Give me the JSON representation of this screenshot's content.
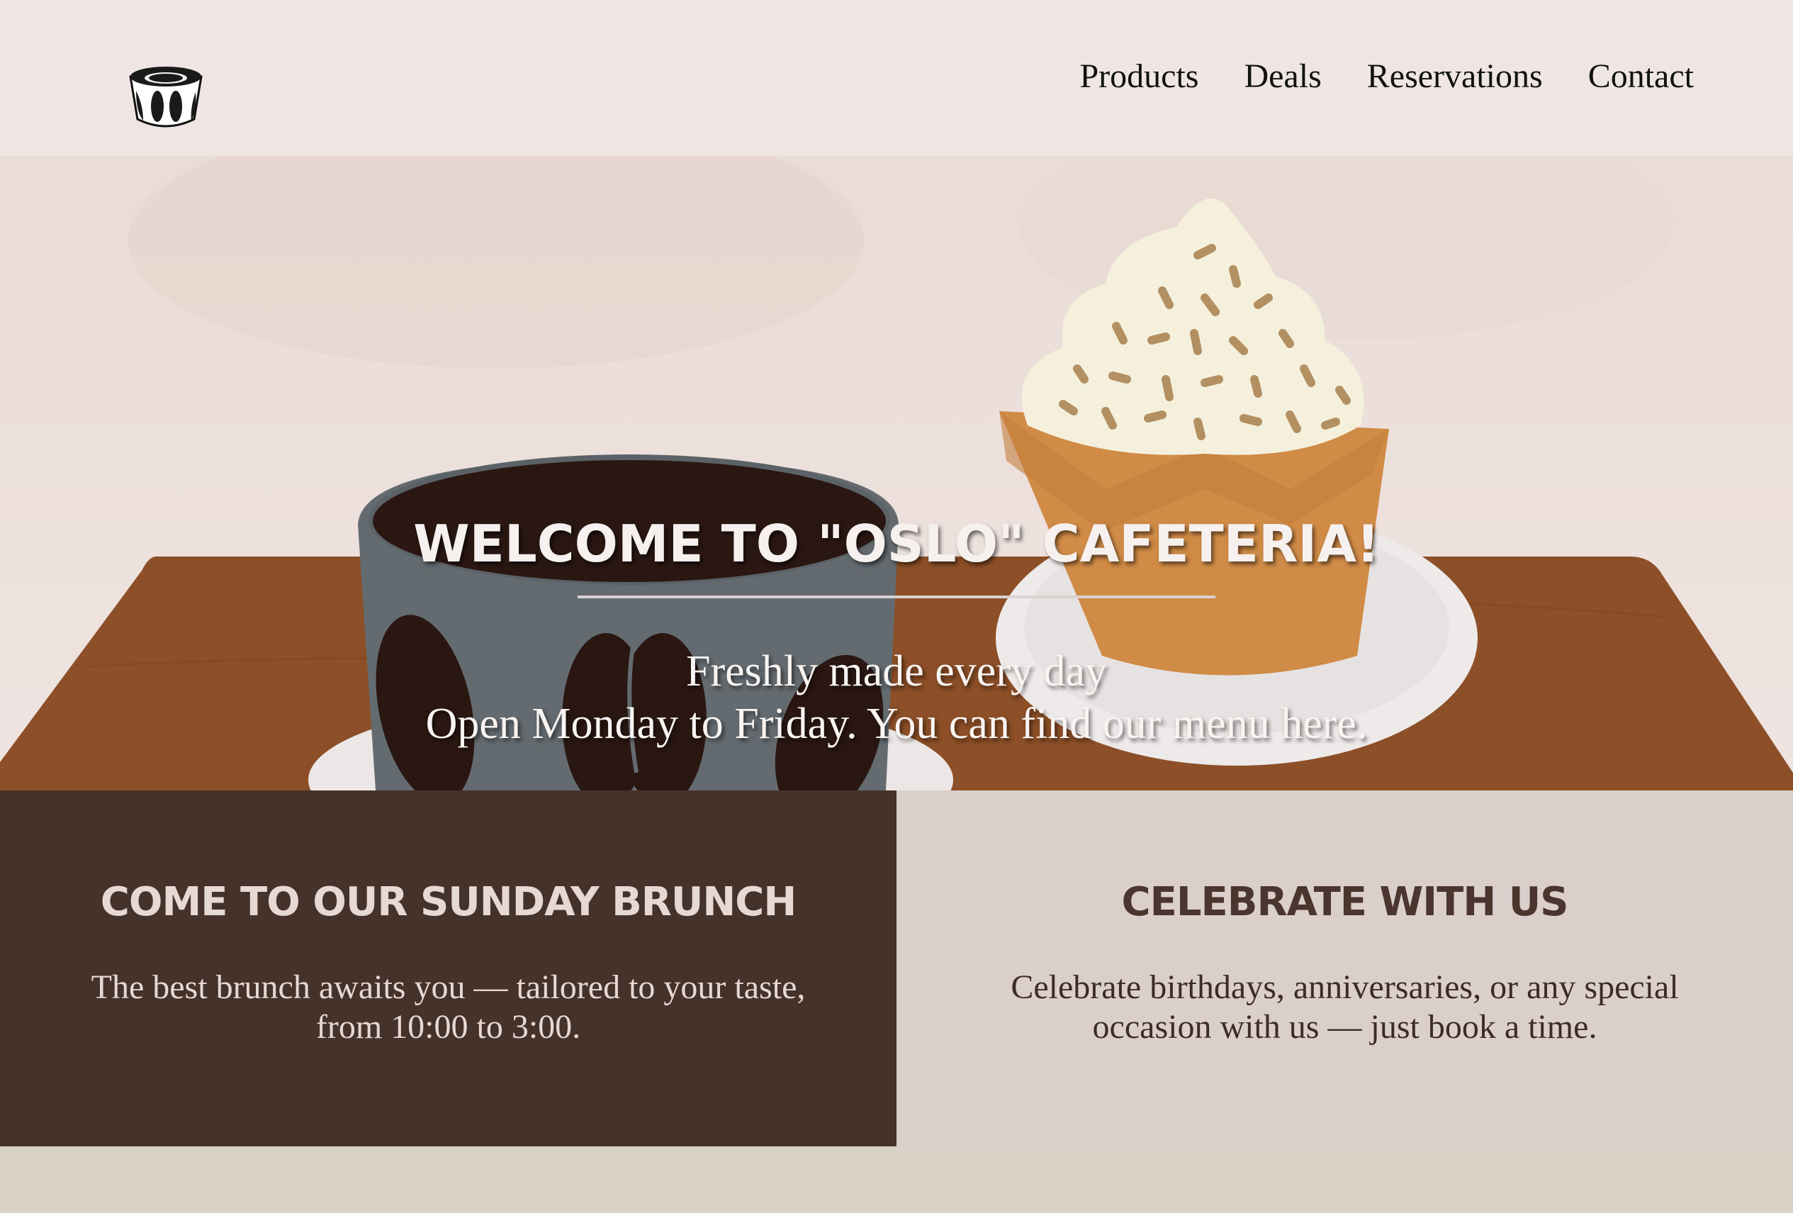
{
  "nav": {
    "items": [
      "Products",
      "Deals",
      "Reservations",
      "Contact"
    ]
  },
  "hero": {
    "title": "WELCOME TO \"OSLO\" CAFETERIA!",
    "line1": "Freshly made every day",
    "line2": "Open Monday to Friday. You can find our menu here."
  },
  "promos": {
    "brunch": {
      "title": "COME TO OUR SUNDAY BRUNCH",
      "line1": "The best brunch awaits you — tailored to your taste,",
      "line2": "from 10:00 to 3:00."
    },
    "celebrate": {
      "title": "CELEBRATE WITH US",
      "line1": "Celebrate birthdays, anniversaries, or any special",
      "line2": "occasion with us — just book a time."
    }
  },
  "colors": {
    "dark_brown": "#45322a",
    "table_brown": "#8c4f27",
    "cup_gray": "#646b70",
    "cupcake_orange": "#d08b46",
    "cream": "#f4f0dc"
  }
}
